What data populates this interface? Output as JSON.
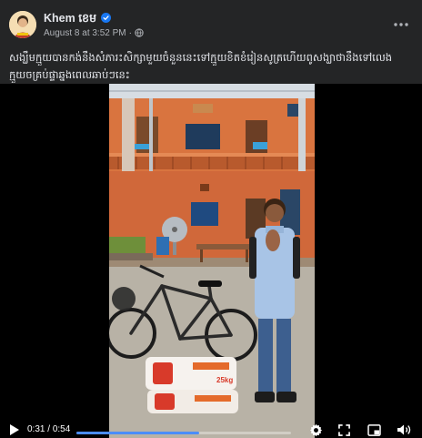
{
  "post": {
    "author": "Khem ខេម",
    "date": "August 8 at 3:52 PM",
    "separator": "·",
    "caption": "សង្ឃឹមក្មួយបានកង់នឹងសំភារះសិក្សាមួយចំនួននេះទៅក្មួយខិតខំរៀនសូត្រហើយពូសង្ឃាថានឹងទៅលេងក្មួយចគ្រប់ផ្ទាឆ្នងពេលឆាប់ៗនេះ"
  },
  "video": {
    "current_time": "0:31",
    "time_separator": " / ",
    "duration": "0:54",
    "progress": 0.57,
    "bag_label": "25kg"
  },
  "colors": {
    "background": "#242526",
    "text": "#e4e6eb",
    "muted": "#b0b3b8",
    "verified": "#1877f2",
    "progress": "#4b8df8"
  },
  "icons": [
    "verified-icon",
    "globe-icon",
    "more-icon",
    "play-icon",
    "settings-icon",
    "fullscreen-icon",
    "miniplayer-icon",
    "volume-icon"
  ]
}
